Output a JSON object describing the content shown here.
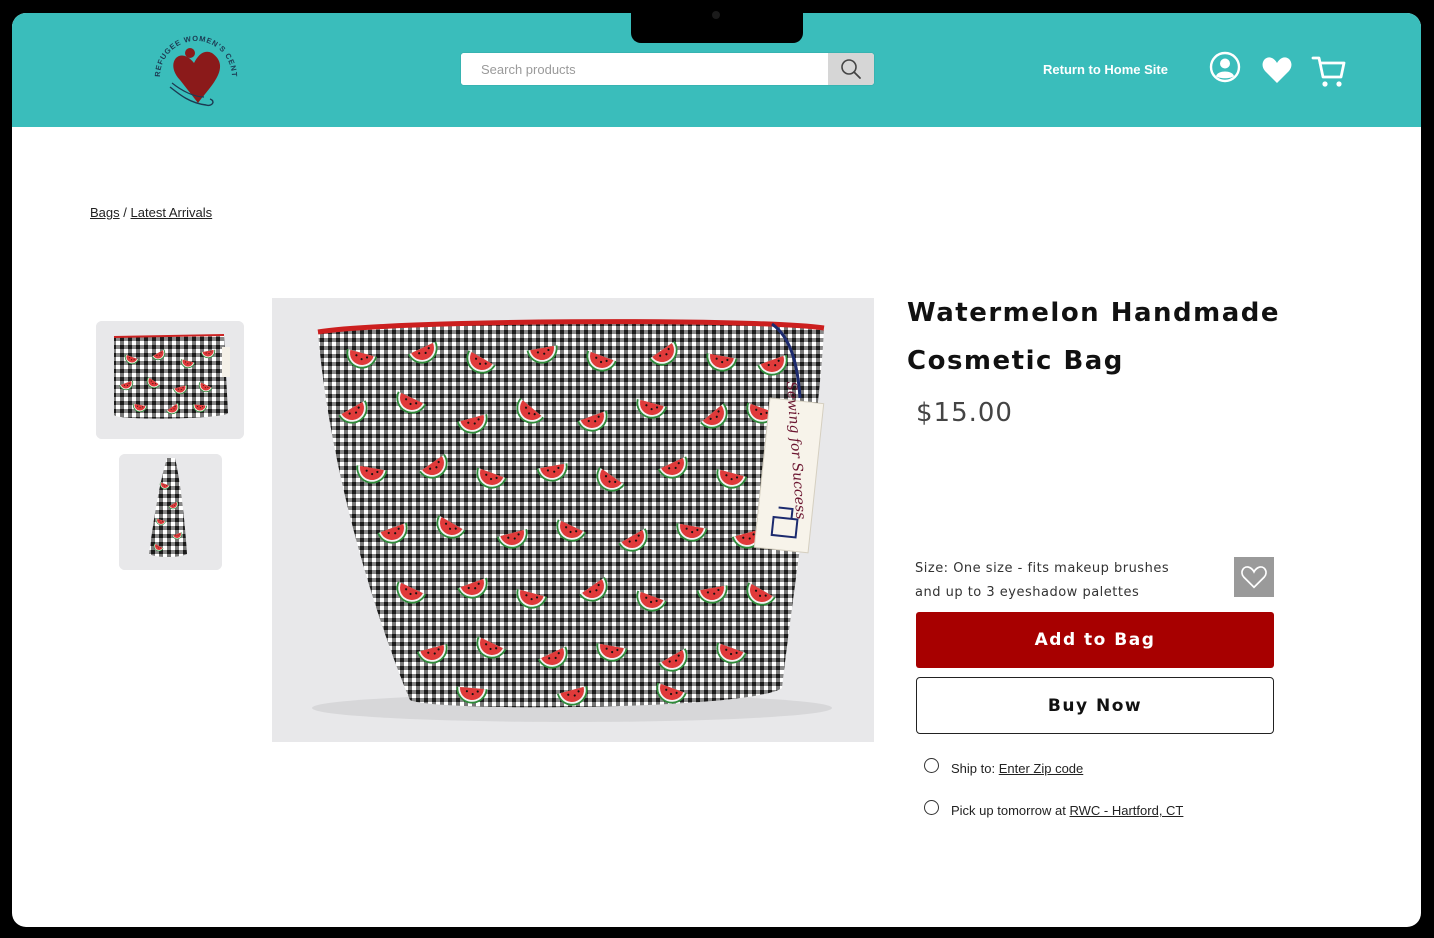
{
  "header": {
    "logo_text": "REFUGEE WOMEN'S CENTER",
    "search_placeholder": "Search products",
    "return_link": "Return to Home Site",
    "icons": [
      "account-icon",
      "heart-icon",
      "cart-icon"
    ],
    "brand_color": "#3abdbb"
  },
  "breadcrumb": {
    "items": [
      "Bags",
      "Latest Arrivals"
    ],
    "separator": "/"
  },
  "gallery": {
    "thumbnails": [
      "front view",
      "side view"
    ],
    "tag_text": "Sewing for Success"
  },
  "product": {
    "title_line1": "Watermelon Handmade",
    "title_line2": "Cosmetic Bag",
    "price": "$15.00",
    "size_line1": "Size: One size - fits makeup brushes",
    "size_line2": "and up to 3 eyeshadow palettes",
    "add_to_bag": "Add to Bag",
    "buy_now": "Buy Now",
    "accent_color": "#a70000"
  },
  "fulfillment": {
    "ship_prefix": "Ship to:",
    "ship_link": "Enter Zip code",
    "pickup_prefix": "Pick up tomorrow at",
    "pickup_link": "RWC - Hartford, CT"
  }
}
